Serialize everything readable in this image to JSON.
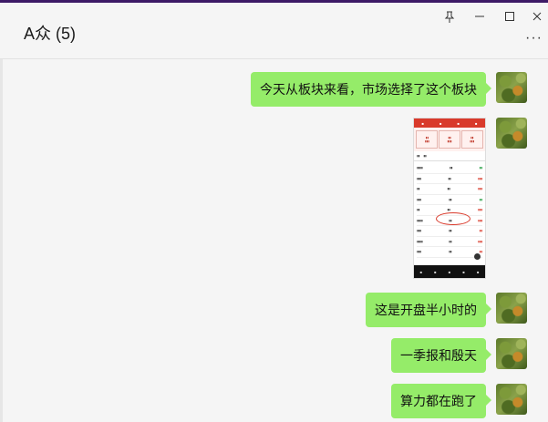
{
  "window": {
    "title": "A众 (5)"
  },
  "titlebar": {
    "pin_icon": "pin-icon",
    "minimize_icon": "minimize-icon",
    "maximize_icon": "maximize-icon",
    "close_icon": "close-icon",
    "more_icon": "more-icon"
  },
  "messages": [
    {
      "type": "text",
      "text": "今天从板块来看，市场选择了这个板块"
    },
    {
      "type": "image",
      "alt": "stock-sector-screenshot"
    },
    {
      "type": "text",
      "text": "这是开盘半小时的"
    },
    {
      "type": "text",
      "text": "一季报和殷天"
    },
    {
      "type": "text",
      "text": "算力都在跑了"
    }
  ],
  "colors": {
    "bubble": "#95ec69",
    "background": "#f5f5f5",
    "accent_top": "#3d1a66"
  }
}
